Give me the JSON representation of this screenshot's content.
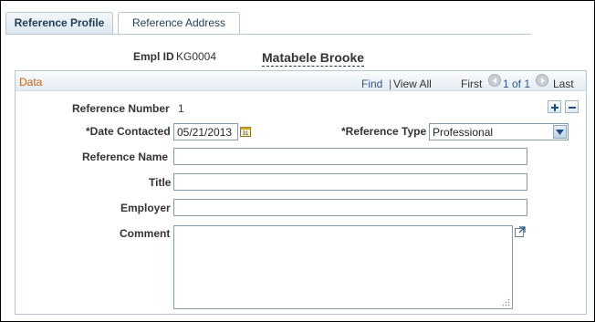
{
  "tabs": [
    {
      "label": "Reference Profile",
      "active": true
    },
    {
      "label": "Reference Address",
      "active": false
    }
  ],
  "header": {
    "empl_id_label": "Empl ID",
    "empl_id_value": "KG0004",
    "employee_name": "Matabele Brooke"
  },
  "data_section": {
    "title": "Data",
    "nav": {
      "find": "Find",
      "separator": "|",
      "view_all": "View All",
      "first": "First",
      "count": "1 of 1",
      "last": "Last"
    }
  },
  "form": {
    "reference_number_label": "Reference Number",
    "reference_number_value": "1",
    "date_contacted_label": "*Date Contacted",
    "date_contacted_value": "05/21/2013",
    "reference_type_label": "*Reference Type",
    "reference_type_value": "Professional",
    "reference_name_label": "Reference Name",
    "reference_name_value": "",
    "title_label": "Title",
    "title_value": "",
    "employer_label": "Employer",
    "employer_value": "",
    "comment_label": "Comment",
    "comment_value": ""
  },
  "colors": {
    "section_title": "#c06a1a",
    "link": "#2a5a8a",
    "border": "#b9c6d2"
  }
}
